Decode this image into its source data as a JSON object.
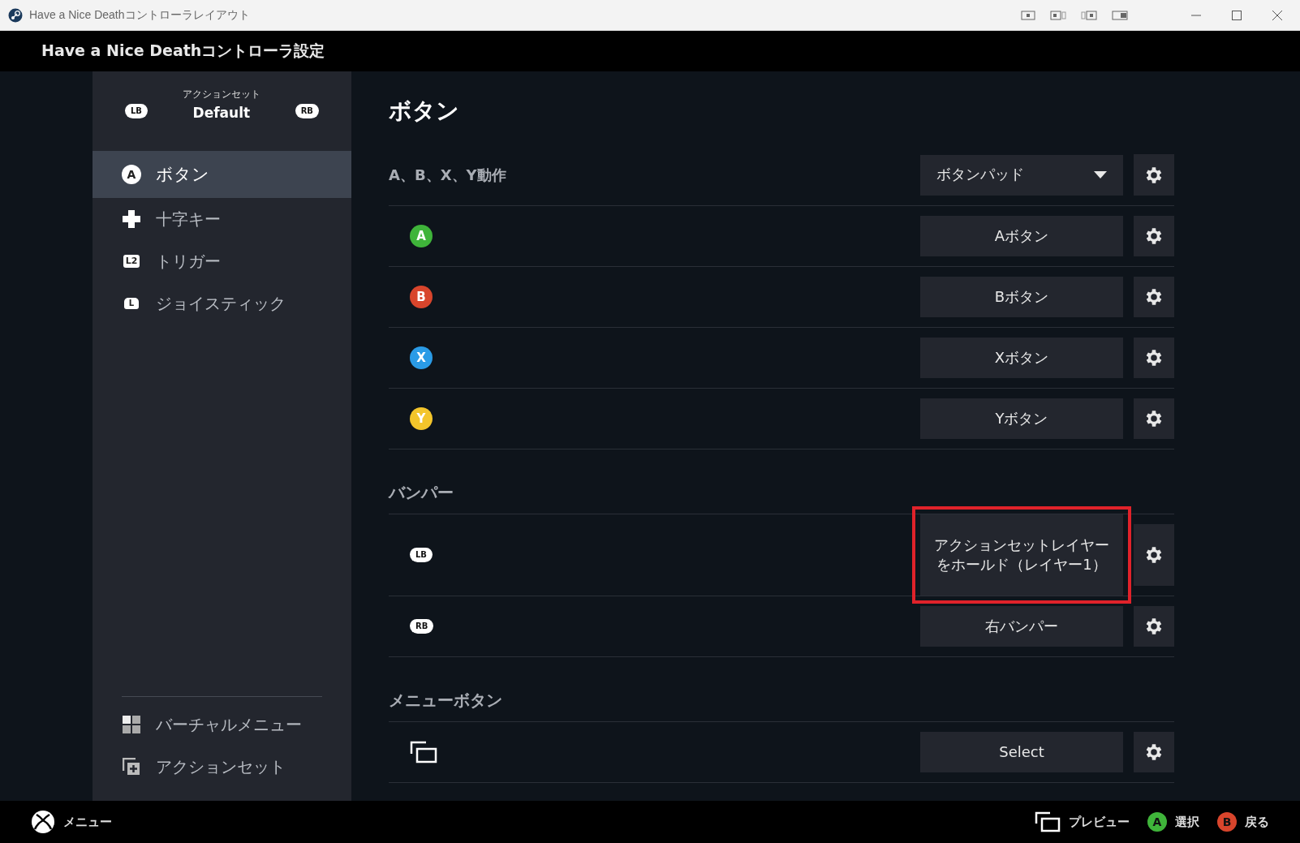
{
  "window": {
    "title": "Have a Nice Deathコントローラレイアウト"
  },
  "header": {
    "title": "Have a Nice Deathコントローラ設定"
  },
  "sidebar": {
    "action_set": {
      "caption": "アクションセット",
      "name": "Default",
      "prev": "LB",
      "next": "RB"
    },
    "items": [
      {
        "kind": "face",
        "icon_text": "A",
        "label": "ボタン",
        "selected": true
      },
      {
        "kind": "dpad",
        "label": "十字キー",
        "selected": false
      },
      {
        "kind": "trigger",
        "icon_text": "L2",
        "label": "トリガー",
        "selected": false
      },
      {
        "kind": "stick",
        "icon_text": "L",
        "label": "ジョイスティック",
        "selected": false
      }
    ],
    "bottom_items": [
      {
        "kind": "grid",
        "label": "バーチャルメニュー",
        "selected": false
      },
      {
        "kind": "layers",
        "label": "アクションセット",
        "selected": false
      }
    ]
  },
  "content": {
    "title": "ボタン",
    "sections": [
      {
        "title": "A、B、X、Y動作",
        "dropdown": "ボタンパッド",
        "rows": [
          {
            "kind": "face",
            "icon_text": "A",
            "color": "#3fb43a",
            "binding": "Aボタン",
            "highlighted": false
          },
          {
            "kind": "face",
            "icon_text": "B",
            "color": "#d8452c",
            "binding": "Bボタン",
            "highlighted": false
          },
          {
            "kind": "face",
            "icon_text": "X",
            "color": "#2a9be6",
            "binding": "Xボタン",
            "highlighted": false
          },
          {
            "kind": "face",
            "icon_text": "Y",
            "color": "#f3c52b",
            "binding": "Yボタン",
            "highlighted": false
          }
        ]
      },
      {
        "title": "バンパー",
        "rows": [
          {
            "kind": "bumper",
            "icon_text": "LB",
            "binding": "アクションセットレイヤーをホールド（レイヤー1）",
            "highlighted": true
          },
          {
            "kind": "bumper",
            "icon_text": "RB",
            "binding": "右バンパー",
            "highlighted": false
          }
        ]
      },
      {
        "title": "メニューボタン",
        "rows": [
          {
            "kind": "select",
            "binding": "Select",
            "highlighted": false
          }
        ]
      }
    ]
  },
  "footer": {
    "left": {
      "kind": "xbox",
      "label": "メニュー"
    },
    "right": [
      {
        "kind": "preview",
        "label": "プレビュー"
      },
      {
        "kind": "face",
        "icon_text": "A",
        "color": "#3fb43a",
        "label": "選択"
      },
      {
        "kind": "face",
        "icon_text": "B",
        "color": "#d8452c",
        "label": "戻る"
      }
    ]
  }
}
